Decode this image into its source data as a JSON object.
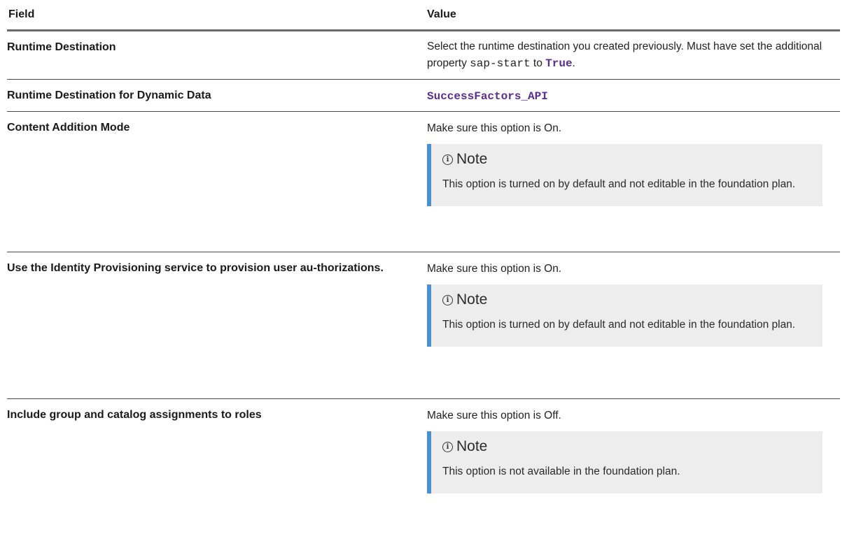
{
  "header": {
    "field": "Field",
    "value": "Value"
  },
  "rows": [
    {
      "field": "Runtime Destination",
      "value_prefix": "Select the runtime destination you created previously. Must have set the additional property ",
      "value_code": "sap-start",
      "value_mid": " to ",
      "value_code2": "True",
      "value_suffix": "."
    },
    {
      "field": "Runtime Destination for Dynamic Data",
      "value_code": "SuccessFactors_API"
    },
    {
      "field": "Content Addition Mode",
      "value": "Make sure this option is On.",
      "note_title": "Note",
      "note_text": "This option is turned on by default and not editable in the foundation plan."
    },
    {
      "field": "Use the Identity Provisioning service to provision user au-thorizations.",
      "value": "Make sure this option is On.",
      "note_title": "Note",
      "note_text": "This option is turned on by default and not editable in the foundation plan."
    },
    {
      "field": "Include group and catalog assignments to roles",
      "value": "Make sure this option is Off.",
      "note_title": "Note",
      "note_text": "This option is not available in the foundation plan."
    }
  ],
  "colors": {
    "note_bar": "#4a8fd0",
    "note_bg": "#ededed",
    "code": "#5b2c91"
  },
  "icons": {
    "note": "info-icon"
  }
}
